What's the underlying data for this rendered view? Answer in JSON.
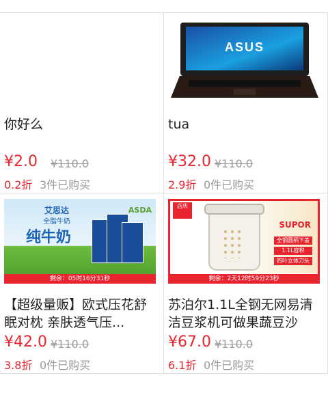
{
  "products": [
    {
      "title": "你好么",
      "price": "¥2.0",
      "original_price": "¥110.0",
      "discount": "0.2折",
      "sold": "3件已购买",
      "image": "blank"
    },
    {
      "title": "tua",
      "price": "¥32.0",
      "original_price": "¥110.0",
      "discount": "2.9折",
      "sold": "0件已购买",
      "image": "laptop",
      "image_text": "ASUS"
    },
    {
      "title": "【超级量贩】欧式压花舒眠对枕 亲肤透气压...",
      "price": "¥42.0",
      "original_price": "¥110.0",
      "discount": "3.8折",
      "sold": "0件已购买",
      "image": "milk",
      "image_text": {
        "brand": "艾思达",
        "sub": "全脂牛奶",
        "big": "纯牛奶",
        "store": "ASDA",
        "countdown": "剩余：05时16分31秒"
      }
    },
    {
      "title": "苏泊尔1.1L全钢无网易清洁豆浆机可做果蔬豆沙",
      "price": "¥67.0",
      "original_price": "¥110.0",
      "discount": "6.1折",
      "sold": "0件已购买",
      "image": "soymilk-maker",
      "image_text": {
        "badge": "店庆",
        "brand": "SUPOR",
        "tags": [
          "全钢圆柄下盖",
          "1.1L容积",
          "四叶立体刀头"
        ],
        "countdown": "剩余：2天12时59分23秒"
      }
    }
  ],
  "colors": {
    "accent": "#e8252f",
    "muted": "#9a9a9a",
    "border": "#e0e0e0"
  }
}
